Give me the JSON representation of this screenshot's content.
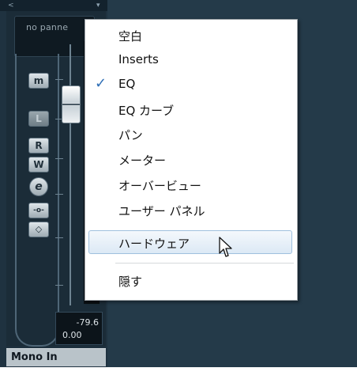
{
  "channel": {
    "pan_display": "no panne",
    "buttons": {
      "monitor": "m",
      "listen": "L",
      "read": "R",
      "write": "W",
      "edit": "e",
      "bypass": "-o-",
      "link": "◇"
    },
    "level_peak": "-79.6",
    "level_volume": "0.00",
    "input_name": "Mono In"
  },
  "context_menu": {
    "items": [
      {
        "label": "空白",
        "checked": false
      },
      {
        "label": "Inserts",
        "checked": false
      },
      {
        "label": "EQ",
        "checked": true
      },
      {
        "label": "EQ カーブ",
        "checked": false
      },
      {
        "label": "パン",
        "checked": false
      },
      {
        "label": "メーター",
        "checked": false
      },
      {
        "label": "オーバービュー",
        "checked": false
      },
      {
        "label": "ユーザー パネル",
        "checked": false
      },
      {
        "label": "ハードウェア",
        "checked": false,
        "hovered": true
      }
    ],
    "after_separator": {
      "label": "隠す"
    },
    "check_glyph": "✓"
  },
  "colors": {
    "accent": "#2f6fb6",
    "highlight": "#dce9f5",
    "background": "#1f3240"
  }
}
